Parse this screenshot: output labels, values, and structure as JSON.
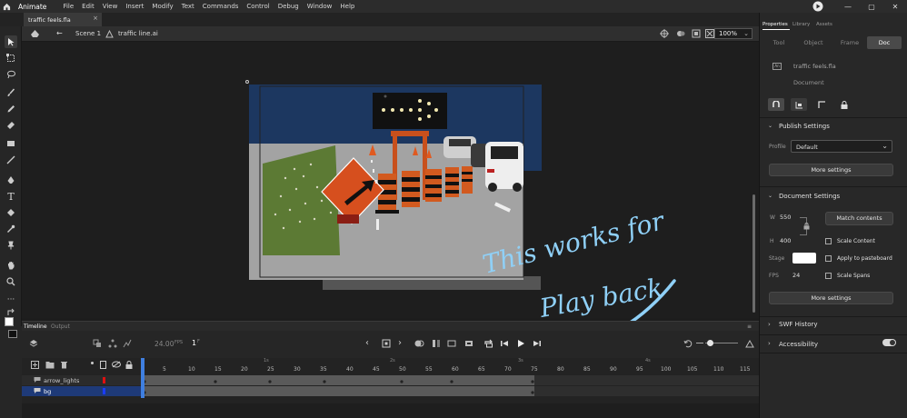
{
  "app": {
    "name": "Animate",
    "menus": [
      "File",
      "Edit",
      "View",
      "Insert",
      "Modify",
      "Text",
      "Commands",
      "Control",
      "Debug",
      "Window",
      "Help"
    ]
  },
  "document_tab": {
    "title": "traffic feels.fla",
    "close": "×"
  },
  "scene_bar": {
    "scene": "Scene 1",
    "symbol": "traffic line.ai",
    "zoom": "100%"
  },
  "timeline": {
    "tab": "Timeline",
    "output_tab": "Output",
    "fps": "24.00",
    "fps_unit": "FPS",
    "frame": "1",
    "frame_unit": "F",
    "frame_numbers": [
      "5",
      "10",
      "15",
      "20",
      "25",
      "30",
      "35",
      "40",
      "45",
      "50",
      "55",
      "60",
      "65",
      "70",
      "75",
      "80",
      "85",
      "90",
      "95",
      "100",
      "105",
      "110",
      "115"
    ],
    "seconds": [
      "1s",
      "2s",
      "3s",
      "4s"
    ],
    "layers": [
      {
        "name": "arrow_lights",
        "color": "#e01010"
      },
      {
        "name": "bg",
        "color": "#1a3cff"
      }
    ]
  },
  "annotation": {
    "line1": "This works for",
    "line2": "Play back",
    "color": "#8fd0f7"
  },
  "properties": {
    "panel_tabs": [
      "Properties",
      "Library",
      "Assets"
    ],
    "segments": [
      "Tool",
      "Object",
      "Frame",
      "Doc"
    ],
    "doc_name": "traffic feels.fla",
    "doc_type": "Document",
    "publish": {
      "title": "Publish Settings",
      "profile_label": "Profile",
      "profile_value": "Default",
      "more": "More settings"
    },
    "document": {
      "title": "Document Settings",
      "w_label": "W",
      "w_value": "550",
      "h_label": "H",
      "h_value": "400",
      "match": "Match contents",
      "scale_content": "Scale Content",
      "stage_label": "Stage",
      "stage_color": "#ffffff",
      "apply_pasteboard": "Apply to pasteboard",
      "fps_label": "FPS",
      "fps_value": "24",
      "scale_spans": "Scale Spans",
      "more": "More settings"
    },
    "swf": "SWF History",
    "accessibility": "Accessibility"
  }
}
